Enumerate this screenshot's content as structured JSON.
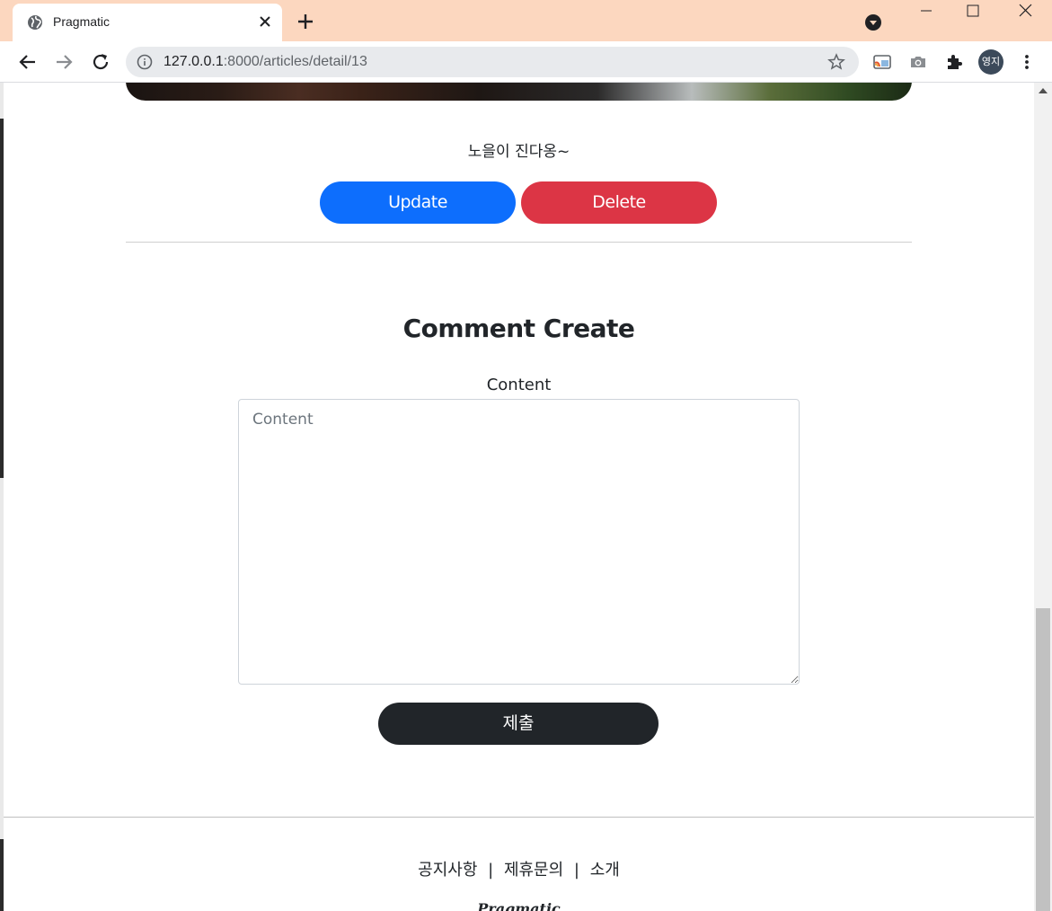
{
  "browser": {
    "tab_title": "Pragmatic",
    "url_host": "127.0.0.1",
    "url_rest": ":8000/articles/detail/13",
    "profile_initials": "영지"
  },
  "article": {
    "content": "노을이 진다옹~",
    "update_label": "Update",
    "delete_label": "Delete"
  },
  "comment_form": {
    "title": "Comment Create",
    "content_label": "Content",
    "content_placeholder": "Content",
    "submit_label": "제출"
  },
  "footer": {
    "links": [
      "공지사항",
      "제휴문의",
      "소개"
    ],
    "separator": "|",
    "brand": "Pragmatic"
  },
  "colors": {
    "update": "#0d6efd",
    "delete": "#dc3545",
    "submit": "#212529",
    "tabbar": "#fcd7bf"
  }
}
